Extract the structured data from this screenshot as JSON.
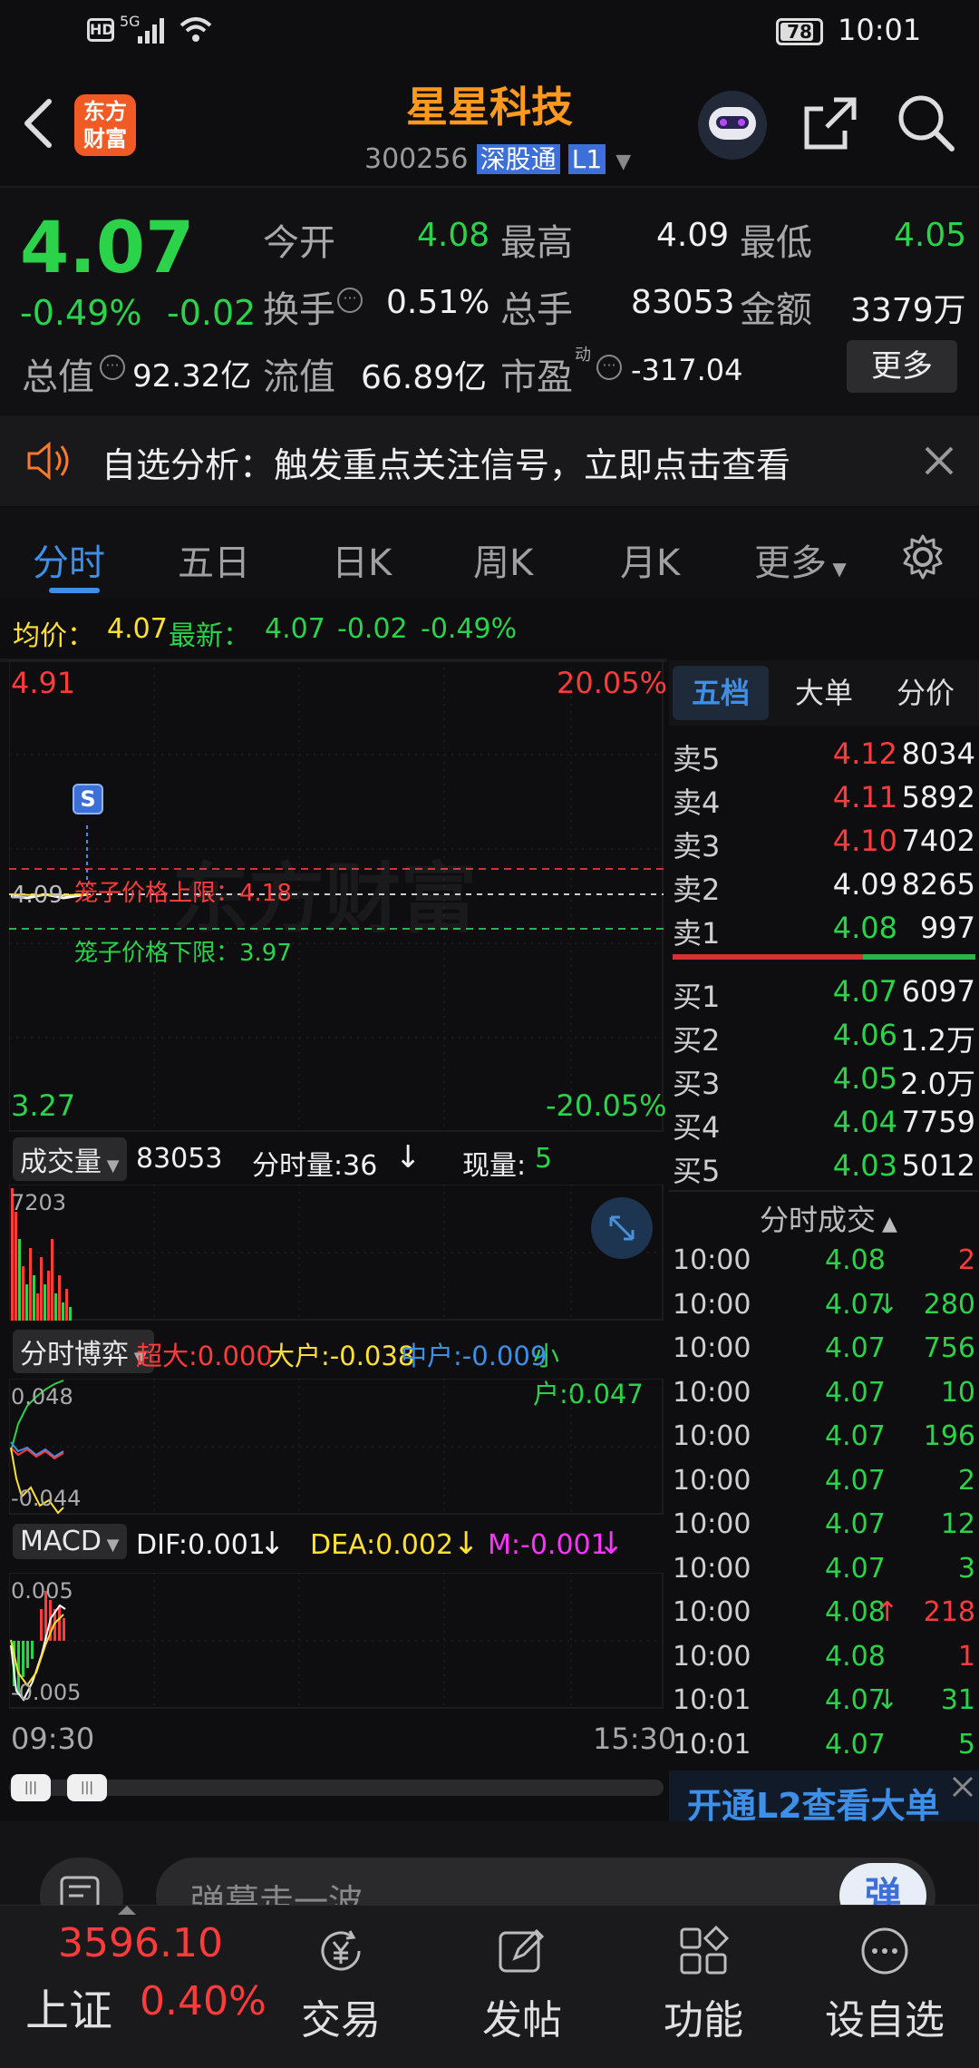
{
  "status_bar": {
    "time": "10:01",
    "battery": "78",
    "network": "5G"
  },
  "header": {
    "app_logo_line1": "东方",
    "app_logo_line2": "财富",
    "stock_name": "星星科技",
    "stock_code": "300256",
    "connect_badge": "深股通",
    "level_badge": "L1"
  },
  "quote": {
    "price": "4.07",
    "change_pct": "-0.49%",
    "change": "-0.02",
    "open_label": "今开",
    "open": "4.08",
    "high_label": "最高",
    "high": "4.09",
    "low_label": "最低",
    "low": "4.05",
    "turnover_label": "换手",
    "turnover": "0.51%",
    "volume_label": "总手",
    "volume": "83053",
    "amount_label": "金额",
    "amount": "3379万",
    "mktcap_label": "总值",
    "mktcap": "92.32亿",
    "float_label": "流值",
    "float": "66.89亿",
    "pe_label": "市盈",
    "pe_sup": "动",
    "pe": "-317.04",
    "more_button": "更多"
  },
  "banner": {
    "text": "自选分析：触发重点关注信号，立即点击查看"
  },
  "tabs": {
    "items": [
      "分时",
      "五日",
      "日K",
      "周K",
      "月K",
      "更多"
    ],
    "active": "分时"
  },
  "avg_line": {
    "avg_label": "均价：",
    "avg": "4.07",
    "latest_label": "最新：",
    "latest": "4.07",
    "chg": "-0.02",
    "chg_pct": "-0.49%"
  },
  "intraday_chart": {
    "top_price": "4.91",
    "top_pct": "20.05%",
    "bottom_price": "3.27",
    "bottom_pct": "-20.05%",
    "upper_limit_text": "笼子价格上限：4.18",
    "lower_limit_text": "笼子价格下限：3.97",
    "ref_price": "4.09",
    "marker": "S",
    "watermark": "东方财富",
    "start_time": "09:30",
    "end_time": "15:30"
  },
  "volume_panel": {
    "selector": "成交量",
    "total": "83053",
    "tick_vol": "分时量:36",
    "cur_label": "现量:",
    "cur_vol": "5",
    "max_label": "7203"
  },
  "flow_panel": {
    "selector": "分时博弈",
    "super_label": "超大:",
    "super": "0.000",
    "big_label": "大户:",
    "big": "-0.038",
    "mid_label": "中户:",
    "mid": "-0.009",
    "small_label": "小户:",
    "small": "0.047",
    "top_label": "0.048",
    "bottom_label": "-0.044"
  },
  "macd_panel": {
    "selector": "MACD",
    "dif": "DIF:0.001",
    "dea": "DEA:0.002",
    "m": "M:-0.001",
    "top_label": "0.005",
    "bottom_label": "-0.005"
  },
  "side_tabs": [
    "五档",
    "大单",
    "分价"
  ],
  "order_book": {
    "asks": [
      {
        "label": "卖5",
        "price": "4.12",
        "vol": "8034",
        "color": "red"
      },
      {
        "label": "卖4",
        "price": "4.11",
        "vol": "5892",
        "color": "red"
      },
      {
        "label": "卖3",
        "price": "4.10",
        "vol": "7402",
        "color": "red"
      },
      {
        "label": "卖2",
        "price": "4.09",
        "vol": "8265",
        "color": "white"
      },
      {
        "label": "卖1",
        "price": "4.08",
        "vol": "997",
        "color": "green"
      }
    ],
    "bids": [
      {
        "label": "买1",
        "price": "4.07",
        "vol": "6097",
        "color": "green"
      },
      {
        "label": "买2",
        "price": "4.06",
        "vol": "1.2万",
        "color": "green"
      },
      {
        "label": "买3",
        "price": "4.05",
        "vol": "2.0万",
        "color": "green"
      },
      {
        "label": "买4",
        "price": "4.04",
        "vol": "7759",
        "color": "green"
      },
      {
        "label": "买5",
        "price": "4.03",
        "vol": "5012",
        "color": "green"
      }
    ]
  },
  "ticks": {
    "title": "分时成交",
    "rows": [
      {
        "time": "10:00",
        "price": "4.08",
        "arrow": "",
        "vol": "2",
        "vcolor": "red"
      },
      {
        "time": "10:00",
        "price": "4.07",
        "arrow": "↓",
        "vol": "280",
        "vcolor": "green"
      },
      {
        "time": "10:00",
        "price": "4.07",
        "arrow": "",
        "vol": "756",
        "vcolor": "green"
      },
      {
        "time": "10:00",
        "price": "4.07",
        "arrow": "",
        "vol": "10",
        "vcolor": "green"
      },
      {
        "time": "10:00",
        "price": "4.07",
        "arrow": "",
        "vol": "196",
        "vcolor": "green"
      },
      {
        "time": "10:00",
        "price": "4.07",
        "arrow": "",
        "vol": "2",
        "vcolor": "green"
      },
      {
        "time": "10:00",
        "price": "4.07",
        "arrow": "",
        "vol": "12",
        "vcolor": "green"
      },
      {
        "time": "10:00",
        "price": "4.07",
        "arrow": "",
        "vol": "3",
        "vcolor": "green"
      },
      {
        "time": "10:00",
        "price": "4.08",
        "arrow": "↑",
        "vol": "218",
        "vcolor": "red"
      },
      {
        "time": "10:00",
        "price": "4.08",
        "arrow": "",
        "vol": "1",
        "vcolor": "red"
      },
      {
        "time": "10:01",
        "price": "4.07",
        "arrow": "↓",
        "vol": "31",
        "vcolor": "green"
      },
      {
        "time": "10:01",
        "price": "4.07",
        "arrow": "",
        "vol": "5",
        "vcolor": "green"
      }
    ],
    "l2_banner": "开通L2查看大单"
  },
  "danmu": {
    "placeholder": "弹幕走一波…",
    "button": "弹"
  },
  "bottom_nav": {
    "index_value": "3596.10",
    "index_name": "上证",
    "index_pct": "0.40%",
    "items": [
      "交易",
      "发帖",
      "功能",
      "设自选"
    ]
  },
  "colors": {
    "up": "#ff3b3b",
    "down": "#2bd34a",
    "accent": "#3d8fe8",
    "title": "#ff9a1f"
  }
}
